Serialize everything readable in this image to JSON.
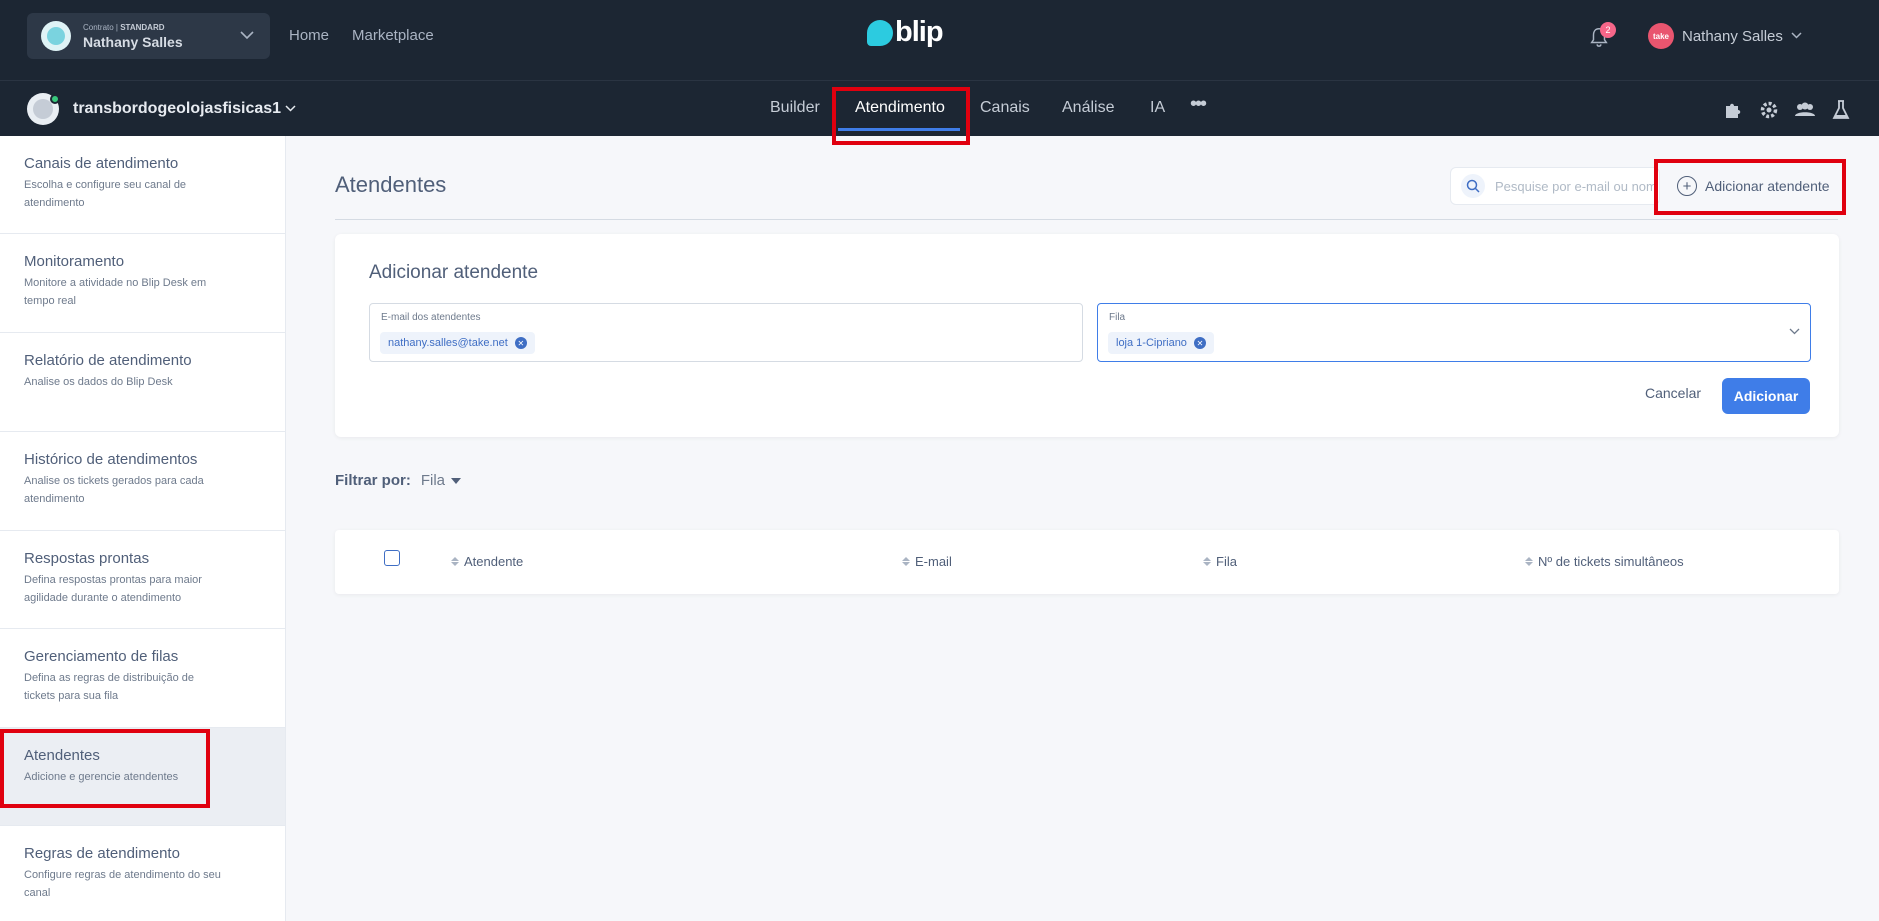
{
  "topbar": {
    "contract_label": "Contrato",
    "contract_plan": "STANDARD",
    "contract_user": "Nathany Salles",
    "nav": [
      "Home",
      "Marketplace"
    ],
    "logo_text": "blip",
    "notification_count": "2",
    "user_avatar_text": "take",
    "user_name": "Nathany Salles"
  },
  "subbar": {
    "bot_name": "transbordogeolojasfisicas1",
    "tabs": [
      "Builder",
      "Atendimento",
      "Canais",
      "Análise",
      "IA"
    ],
    "active_tab": "Atendimento",
    "more": "•••"
  },
  "sidebar": {
    "items": [
      {
        "title": "Canais de atendimento",
        "desc": "Escolha e configure seu canal de atendimento"
      },
      {
        "title": "Monitoramento",
        "desc": "Monitore a atividade no Blip Desk em tempo real"
      },
      {
        "title": "Relatório de atendimento",
        "desc": "Analise os dados do Blip Desk"
      },
      {
        "title": "Histórico de atendimentos",
        "desc": "Analise os tickets gerados para cada atendimento"
      },
      {
        "title": "Respostas prontas",
        "desc": "Defina respostas prontas para maior agilidade durante o atendimento"
      },
      {
        "title": "Gerenciamento de filas",
        "desc": "Defina as regras de distribuição de tickets para sua fila"
      },
      {
        "title": "Atendentes",
        "desc": "Adicione e gerencie atendentes"
      },
      {
        "title": "Regras de atendimento",
        "desc": "Configure regras de atendimento do seu canal"
      }
    ],
    "active": "Atendentes"
  },
  "main": {
    "title": "Atendentes",
    "search_placeholder": "Pesquise por e-mail ou nome",
    "add_button": "Adicionar atendente",
    "form": {
      "title": "Adicionar atendente",
      "email_label": "E-mail dos atendentes",
      "email_chip": "nathany.salles@take.net",
      "queue_label": "Fila",
      "queue_chip": "loja 1-Cipriano",
      "cancel": "Cancelar",
      "submit": "Adicionar"
    },
    "filter": {
      "label": "Filtrar por:",
      "value": "Fila"
    },
    "table": {
      "columns": [
        "Atendente",
        "E-mail",
        "Fila",
        "Nº de tickets simultâneos"
      ]
    }
  },
  "colors": {
    "topbar_bg": "#1c2633",
    "accent": "#3f7de8",
    "highlight": "#e0000f",
    "brand": "#2ccbe0"
  },
  "icons": [
    "chevron-down-icon",
    "bell-icon",
    "puzzle-icon",
    "gear-icon",
    "team-icon",
    "flask-icon",
    "search-icon",
    "plus-circle-icon",
    "close-icon",
    "sort-icon"
  ]
}
